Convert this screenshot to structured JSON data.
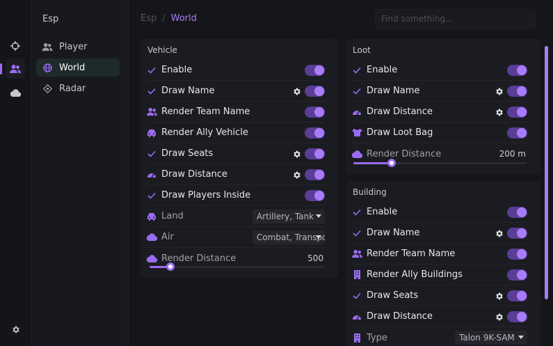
{
  "sidebar": {
    "title": "Esp",
    "items": [
      {
        "label": "Player",
        "icon": "users-icon"
      },
      {
        "label": "World",
        "icon": "globe-icon"
      },
      {
        "label": "Radar",
        "icon": "radar-icon"
      }
    ]
  },
  "breadcrumb": {
    "root": "Esp",
    "separator": "/",
    "current": "World"
  },
  "search": {
    "placeholder": "Find something..."
  },
  "vehicle": {
    "title": "Vehicle",
    "enable": "Enable",
    "draw_name": "Draw Name",
    "render_team_name": "Render Team Name",
    "render_ally_vehicle": "Render Ally Vehicle",
    "draw_seats": "Draw Seats",
    "draw_distance": "Draw Distance",
    "draw_players_inside": "Draw Players Inside",
    "land_label": "Land",
    "land_value": "Artillery, Tank",
    "air_label": "Air",
    "air_value": "Combat, Transport",
    "render_distance_label": "Render Distance",
    "render_distance_value": "500",
    "render_distance_fraction": 0.12
  },
  "loot": {
    "title": "Loot",
    "enable": "Enable",
    "draw_name": "Draw Name",
    "draw_distance": "Draw Distance",
    "draw_loot_bag": "Draw Loot Bag",
    "render_distance_label": "Render Distance",
    "render_distance_value": "200 m",
    "render_distance_fraction": 0.22
  },
  "building": {
    "title": "Building",
    "enable": "Enable",
    "draw_name": "Draw Name",
    "render_team_name": "Render Team Name",
    "render_ally_buildings": "Render Ally Buildings",
    "draw_seats": "Draw Seats",
    "draw_distance": "Draw Distance",
    "type_label": "Type",
    "type_value": "Talon 9K-SAM"
  },
  "colors": {
    "accent": "#9b6cf2",
    "toggle_track": "#5a3d96",
    "background": "#15161a",
    "panel": "#1b1c21"
  }
}
